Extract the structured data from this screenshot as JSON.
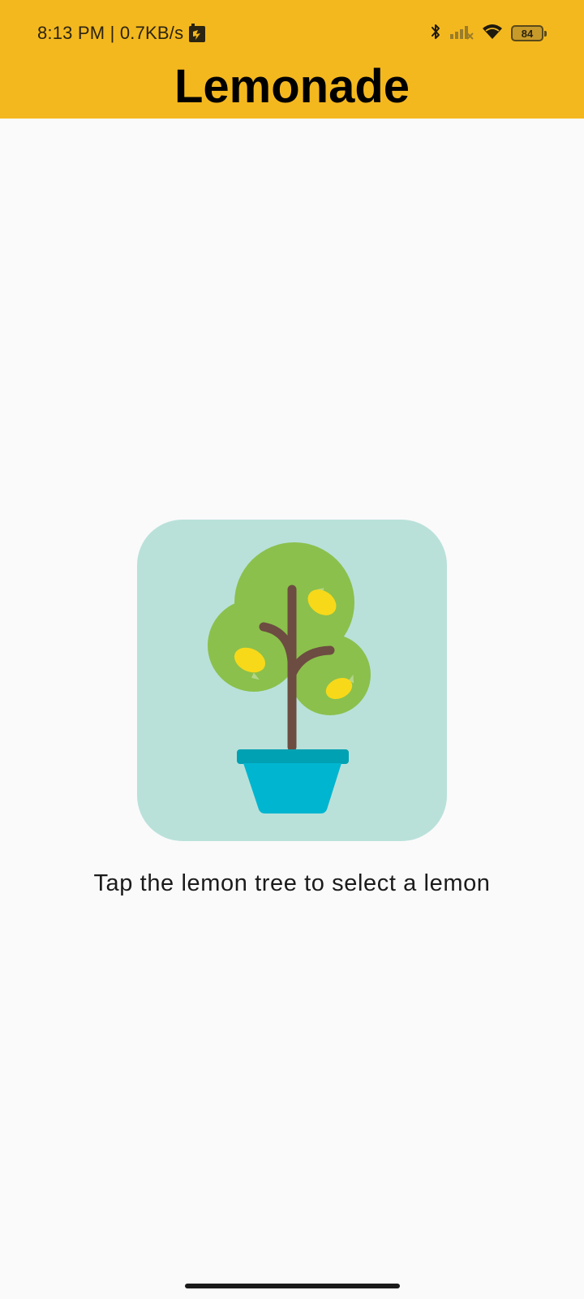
{
  "status_bar": {
    "time_speed": "8:13 PM | 0.7KB/s",
    "battery_level": "84",
    "icons": [
      "notification-app-icon",
      "bluetooth-icon",
      "signal-icon",
      "wifi-icon",
      "battery-icon"
    ]
  },
  "app": {
    "title": "Lemonade",
    "accent_color": "#f4b81f"
  },
  "main": {
    "image_label": "lemon tree",
    "instruction": "Tap the lemon tree to select a lemon",
    "tile_color": "#b9e1da"
  }
}
